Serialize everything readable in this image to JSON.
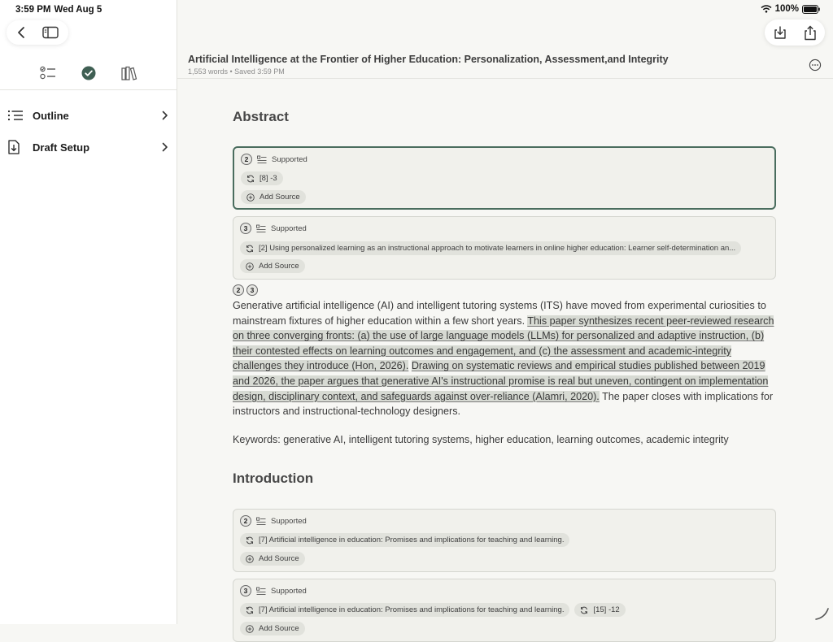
{
  "status": {
    "time": "3:59 PM",
    "date": "Wed Aug 5",
    "battery": "100%"
  },
  "sidebar": {
    "items": [
      {
        "label": "Outline",
        "icon": "list-icon"
      },
      {
        "label": "Draft Setup",
        "icon": "document-download-icon"
      }
    ]
  },
  "document": {
    "title": "Artificial Intelligence at the Frontier of Higher Education: Personalization, Assessment,and Integrity",
    "meta": "1,553 words • Saved 3:59 PM"
  },
  "sections": {
    "abstract": "Abstract",
    "introduction": "Introduction"
  },
  "cards": [
    {
      "number": "2",
      "status": "Supported",
      "sources": [
        "[8] -3"
      ],
      "add_label": "Add Source"
    },
    {
      "number": "3",
      "status": "Supported",
      "sources": [
        "[2] Using personalized learning as an instructional approach to motivate learners in online higher education: Learner self-determination an..."
      ],
      "add_label": "Add Source"
    },
    {
      "number": "2",
      "status": "Supported",
      "sources": [
        "[7] Artificial intelligence in education: Promises and implications for teaching and learning."
      ],
      "add_label": "Add Source"
    },
    {
      "number": "3",
      "status": "Supported",
      "sources": [
        "[7] Artificial intelligence in education: Promises and implications for teaching and learning.",
        "[15] -12"
      ],
      "add_label": "Add Source"
    }
  ],
  "claim_markers": [
    "2",
    "3"
  ],
  "abstract_text": {
    "part1": "Generative artificial intelligence (AI) and intelligent tutoring systems (ITS) have moved from experimental curiosities to mainstream fixtures of higher education within a few short years. ",
    "claim2": "This paper synthesizes recent peer-reviewed research on three converging fronts: (a) the use of large language models (LLMs) for personalized and adaptive instruction, (b) their contested effects on learning outcomes and engagement, and (c) the assessment and academic-integrity challenges they introduce (Hon, 2026).",
    "space": " ",
    "claim3": "Drawing on systematic reviews and empirical studies published between 2019 and 2026, the paper argues that generative AI's instructional promise is real but uneven, contingent on implementation design, disciplinary context, and safeguards against over-reliance (Alamri, 2020).",
    "part2": " The paper closes with implications for instructors and instructional-technology designers."
  },
  "keywords": "Keywords: generative AI, intelligent tutoring systems, higher education, learning outcomes, academic integrity",
  "colors": {
    "accent": "#4a6d5e",
    "highlight": "#d7dad3",
    "card_bg": "#f1f1ec"
  }
}
